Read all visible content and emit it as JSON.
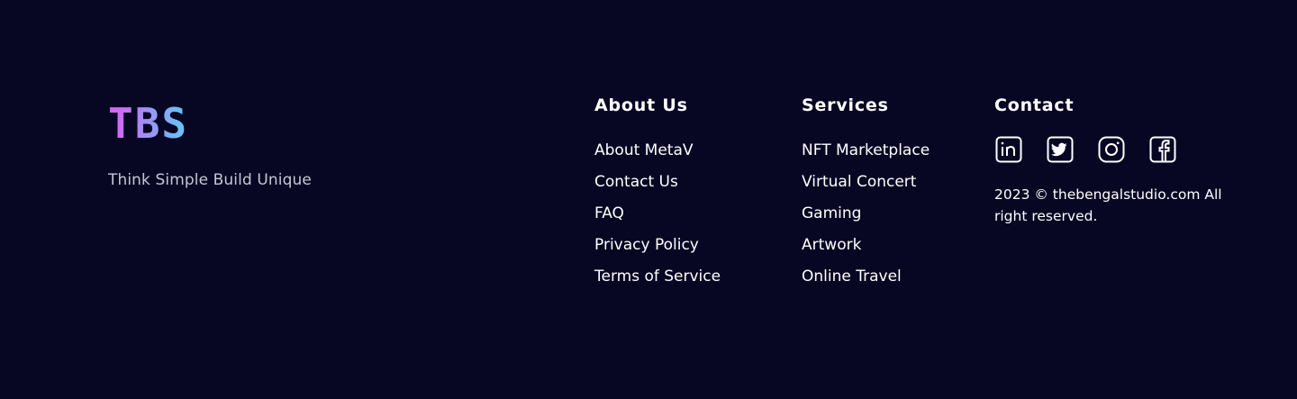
{
  "brand": {
    "logo_text": "TBS",
    "tagline": "Think Simple Build Unique",
    "gradient": [
      "#e25cf5",
      "#a58cf6",
      "#5fc9f6"
    ]
  },
  "about": {
    "title": "About Us",
    "items": [
      "About MetaV",
      "Contact Us",
      "FAQ",
      "Privacy Policy",
      "Terms of Service"
    ]
  },
  "services": {
    "title": "Services",
    "items": [
      "NFT Marketplace",
      "Virtual Concert",
      "Gaming",
      "Artwork",
      "Online Travel"
    ]
  },
  "contact": {
    "title": "Contact",
    "social": [
      "linkedin-icon",
      "twitter-icon",
      "instagram-icon",
      "facebook-icon"
    ],
    "copyright": "2023 © thebengalstudio.com All right reserved."
  },
  "colors": {
    "background": "#070723",
    "text": "#ffffff",
    "muted_text": "#c5c6d6"
  }
}
